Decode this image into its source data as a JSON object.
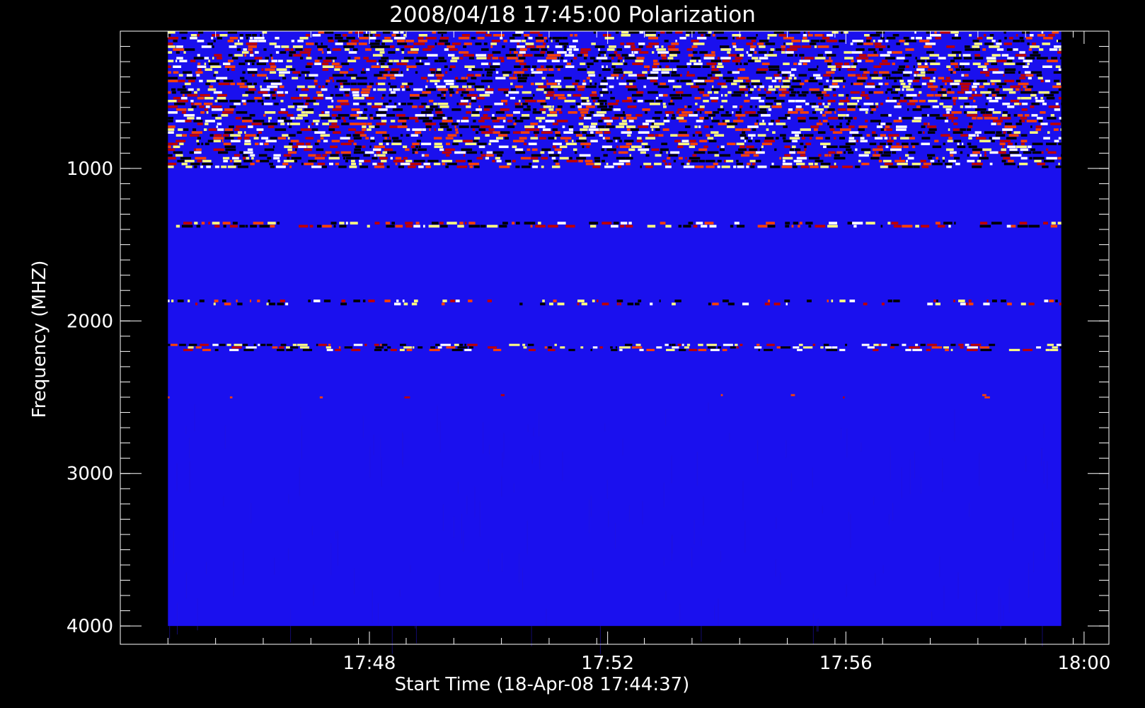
{
  "chart_data": {
    "type": "heatmap",
    "title": "2008/04/18 17:45:00 Polarization",
    "xlabel": "Start Time (18-Apr-08 17:44:37)",
    "ylabel": "Frequency (MHZ)",
    "x_ticks": [
      {
        "label": "17:48",
        "minutes": 3.383
      },
      {
        "label": "17:52",
        "minutes": 7.383
      },
      {
        "label": "17:56",
        "minutes": 11.383
      },
      {
        "label": "18:00",
        "minutes": 15.383
      }
    ],
    "x_minor_step_minutes": 0.8,
    "x_range_minutes": [
      -0.8,
      15.8
    ],
    "data_x_range_minutes": [
      0.0,
      15.0
    ],
    "y_ticks": [
      {
        "label": "1000",
        "value": 1000
      },
      {
        "label": "2000",
        "value": 2000
      },
      {
        "label": "3000",
        "value": 3000
      },
      {
        "label": "4000",
        "value": 4000
      }
    ],
    "y_minor_step": 100,
    "y_range": [
      100,
      4120
    ],
    "data_y_range": [
      100,
      4000
    ],
    "y_reversed": true,
    "colormap": [
      "#000000",
      "#1a10ee",
      "#c00000",
      "#ff4000",
      "#ffff80",
      "#ffffff"
    ],
    "background_color": "#1a10ee",
    "bands": [
      {
        "freq_range": [
          100,
          1000
        ],
        "description": "dense noisy interference",
        "intensity": "high"
      },
      {
        "freq_range": [
          1350,
          1390
        ],
        "description": "white/yellow interference line",
        "intensity": "high"
      },
      {
        "freq_range": [
          1860,
          1900
        ],
        "description": "intermittent red/black line",
        "intensity": "medium"
      },
      {
        "freq_range": [
          2150,
          2200
        ],
        "description": "strong yellow/white bursts",
        "intensity": "high"
      },
      {
        "freq_range": [
          2480,
          2510
        ],
        "description": "sparse red spots",
        "intensity": "low"
      },
      {
        "freq_range": [
          2510,
          4000
        ],
        "description": "quiet background",
        "intensity": "none"
      }
    ]
  }
}
